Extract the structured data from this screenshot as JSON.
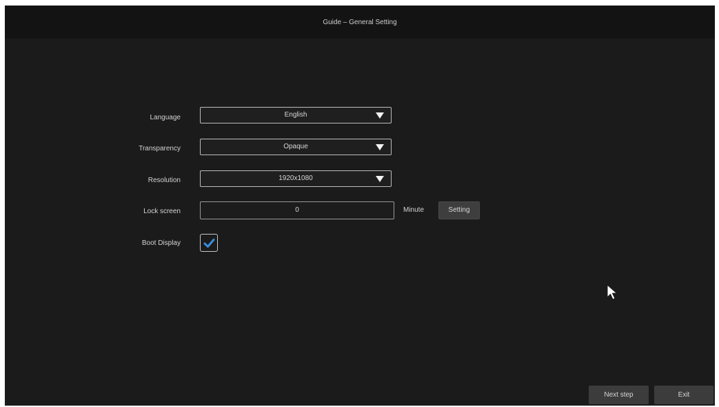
{
  "window": {
    "title": "Guide – General Setting"
  },
  "settings": {
    "language": {
      "label": "Language",
      "value": "English"
    },
    "transparency": {
      "label": "Transparency",
      "value": "Opaque"
    },
    "resolution": {
      "label": "Resolution",
      "value": "1920x1080"
    },
    "lock_screen": {
      "label": "Lock screen",
      "value": "0",
      "unit": "Minute",
      "setting_label": "Setting"
    },
    "boot_display": {
      "label": "Boot Display",
      "checked": true
    }
  },
  "footer": {
    "next_label": "Next step",
    "exit_label": "Exit"
  },
  "colors": {
    "background": "#1b1b1b",
    "titlebar": "#131313",
    "checkmark": "#3a8fe0",
    "button": "#3c3c3c"
  },
  "icons": {
    "dropdown": "caret-down-icon",
    "checkbox": "checkmark-icon",
    "pointer": "mouse-pointer-icon"
  }
}
